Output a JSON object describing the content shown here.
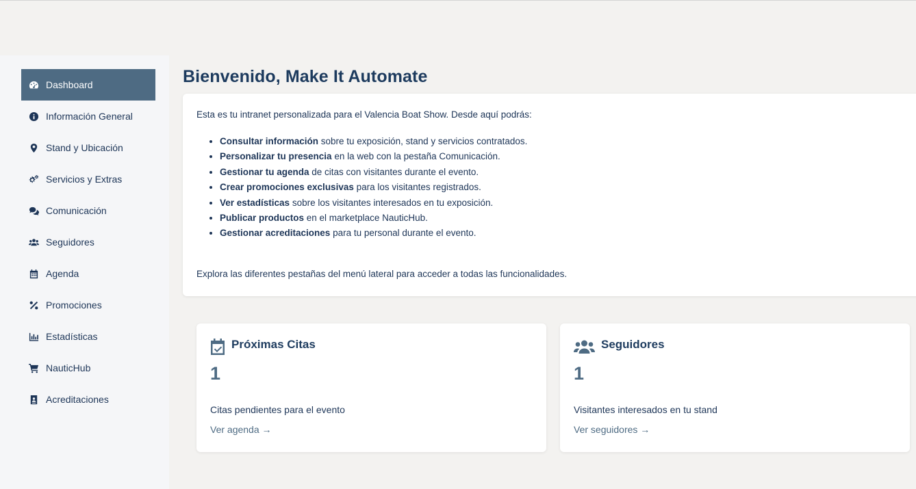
{
  "sidebar": {
    "items": [
      {
        "label": "Dashboard",
        "icon": "dashboard-icon",
        "active": true
      },
      {
        "label": "Información General",
        "icon": "info-icon"
      },
      {
        "label": "Stand y Ubicación",
        "icon": "map-pin-icon"
      },
      {
        "label": "Servicios y Extras",
        "icon": "gears-icon"
      },
      {
        "label": "Comunicación",
        "icon": "comments-icon"
      },
      {
        "label": "Seguidores",
        "icon": "users-icon"
      },
      {
        "label": "Agenda",
        "icon": "calendar-icon"
      },
      {
        "label": "Promociones",
        "icon": "percent-icon"
      },
      {
        "label": "Estadísticas",
        "icon": "chart-icon"
      },
      {
        "label": "NauticHub",
        "icon": "cart-icon"
      },
      {
        "label": "Acreditaciones",
        "icon": "id-badge-icon"
      }
    ]
  },
  "main": {
    "title": "Bienvenido, Make It Automate",
    "intro": "Esta es tu intranet personalizada para el Valencia Boat Show. Desde aquí podrás:",
    "bullets": [
      {
        "bold": "Consultar información",
        "rest": " sobre tu exposición, stand y servicios contratados."
      },
      {
        "bold": "Personalizar tu presencia",
        "rest": " en la web con la pestaña Comunicación."
      },
      {
        "bold": "Gestionar tu agenda",
        "rest": " de citas con visitantes durante el evento."
      },
      {
        "bold": "Crear promociones exclusivas",
        "rest": " para los visitantes registrados."
      },
      {
        "bold": "Ver estadísticas",
        "rest": " sobre los visitantes interesados en tu exposición."
      },
      {
        "bold": "Publicar productos",
        "rest": " en el marketplace NauticHub."
      },
      {
        "bold": "Gestionar acreditaciones",
        "rest": " para tu personal durante el evento."
      }
    ],
    "outro": "Explora las diferentes pestañas del menú lateral para acceder a todas las funcionalidades."
  },
  "cards": {
    "citas": {
      "icon": "calendar-check-icon",
      "title": "Próximas Citas",
      "count": "1",
      "desc": "Citas pendientes para el evento",
      "link": "Ver agenda →"
    },
    "seguidores": {
      "icon": "users-icon",
      "title": "Seguidores",
      "count": "1",
      "desc": "Visitantes interesados en tu stand",
      "link": "Ver seguidores →"
    }
  },
  "colors": {
    "accent": "#4e6b83",
    "text": "#1d3557",
    "background": "#f3f2f0",
    "sidebar": "#f5f6f8"
  }
}
